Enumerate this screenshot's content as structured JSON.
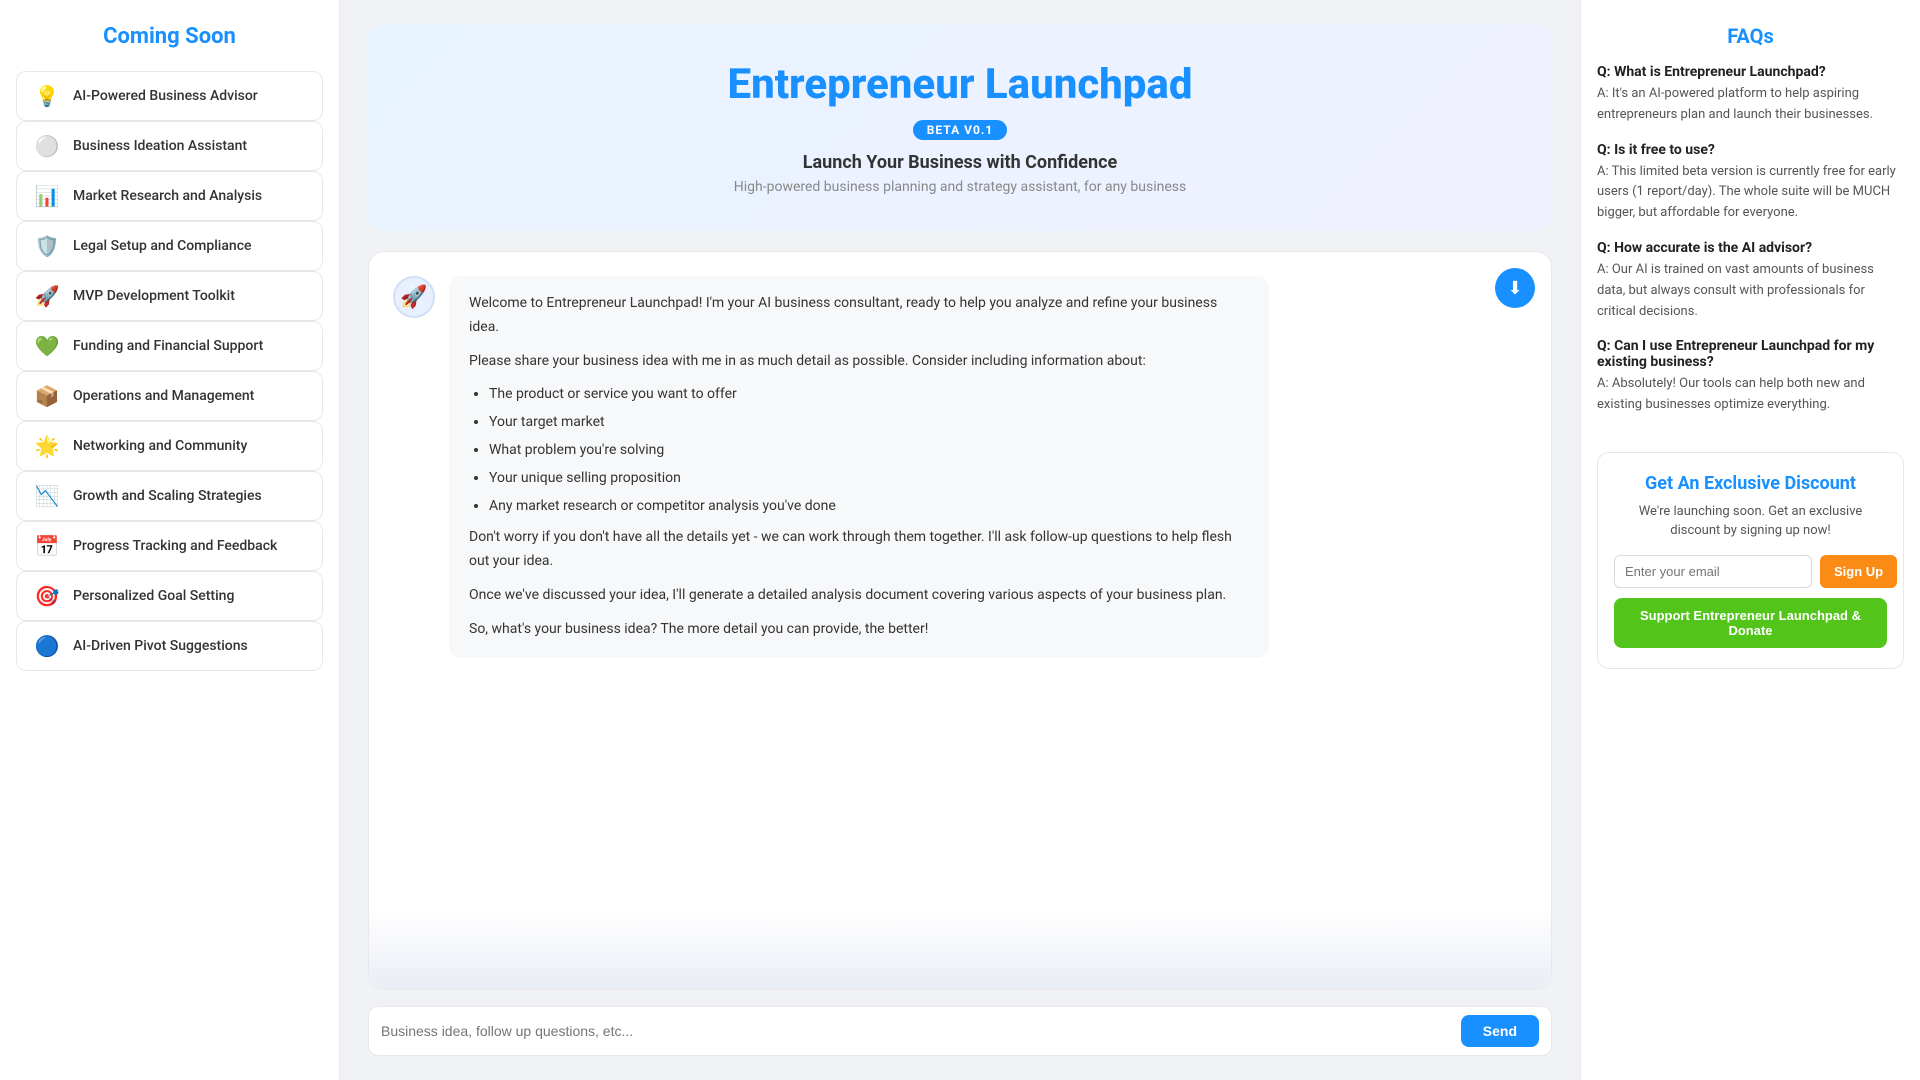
{
  "sidebar": {
    "title": "Coming Soon",
    "items": [
      {
        "id": "ai-advisor",
        "icon": "💡",
        "label": "AI-Powered Business Advisor"
      },
      {
        "id": "business-ideation",
        "icon": "⚪",
        "label": "Business Ideation Assistant"
      },
      {
        "id": "market-research",
        "icon": "📊",
        "label": "Market Research and Analysis"
      },
      {
        "id": "legal-setup",
        "icon": "🛡️",
        "label": "Legal Setup and Compliance"
      },
      {
        "id": "mvp-toolkit",
        "icon": "🚀",
        "label": "MVP Development Toolkit"
      },
      {
        "id": "funding",
        "icon": "💚",
        "label": "Funding and Financial Support"
      },
      {
        "id": "operations",
        "icon": "📦",
        "label": "Operations and Management"
      },
      {
        "id": "networking",
        "icon": "🌟",
        "label": "Networking and Community"
      },
      {
        "id": "growth",
        "icon": "📉",
        "label": "Growth and Scaling Strategies"
      },
      {
        "id": "progress",
        "icon": "📅",
        "label": "Progress Tracking and Feedback"
      },
      {
        "id": "goal-setting",
        "icon": "🎯",
        "label": "Personalized Goal Setting"
      },
      {
        "id": "pivot",
        "icon": "🔵",
        "label": "AI-Driven Pivot Suggestions"
      }
    ]
  },
  "hero": {
    "title": "Entrepreneur Launchpad",
    "beta_badge": "BETA V0.1",
    "subtitle": "Launch Your Business with Confidence",
    "description": "High-powered business planning and strategy assistant, for any business"
  },
  "chat": {
    "welcome_message_1": "Welcome to Entrepreneur Launchpad! I'm your AI business consultant, ready to help you analyze and refine your business idea.",
    "welcome_message_2": "Please share your business idea with me in as much detail as possible. Consider including information about:",
    "bullet_points": [
      "The product or service you want to offer",
      "Your target market",
      "What problem you're solving",
      "Your unique selling proposition",
      "Any market research or competitor analysis you've done"
    ],
    "welcome_message_3": "Don't worry if you don't have all the details yet - we can work through them together. I'll ask follow-up questions to help flesh out your idea.",
    "welcome_message_4": "Once we've discussed your idea, I'll generate a detailed analysis document covering various aspects of your business plan.",
    "welcome_message_5": "So, what's your business idea? The more detail you can provide, the better!",
    "input_placeholder": "Business idea, follow up questions, etc...",
    "send_button": "Send"
  },
  "faqs": {
    "title": "FAQs",
    "items": [
      {
        "question": "Q: What is Entrepreneur Launchpad?",
        "answer": "A: It's an AI-powered platform to help aspiring entrepreneurs plan and launch their businesses."
      },
      {
        "question": "Q: Is it free to use?",
        "answer": "A: This limited beta version is currently free for early users (1 report/day). The whole suite will be MUCH bigger, but affordable for everyone."
      },
      {
        "question": "Q: How accurate is the AI advisor?",
        "answer": "A: Our AI is trained on vast amounts of business data, but always consult with professionals for critical decisions."
      },
      {
        "question": "Q: Can I use Entrepreneur Launchpad for my existing business?",
        "answer": "A: Absolutely! Our tools can help both new and existing businesses optimize everything."
      }
    ]
  },
  "discount": {
    "title": "Get An Exclusive Discount",
    "description": "We're launching soon. Get an exclusive discount by signing up now!",
    "email_placeholder": "Enter your email",
    "signup_button": "Sign Up",
    "donate_button": "Support Entrepreneur Launchpad & Donate"
  }
}
